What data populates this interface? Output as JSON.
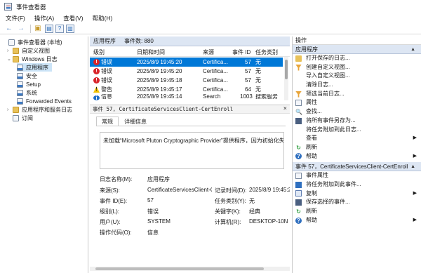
{
  "window": {
    "title": "事件查看器"
  },
  "menu": [
    "文件(F)",
    "操作(A)",
    "查看(V)",
    "帮助(H)"
  ],
  "tree": [
    {
      "label": "事件查看器 (本地)",
      "level": 0,
      "arrow": "",
      "icon": "log"
    },
    {
      "label": "自定义视图",
      "level": 1,
      "arrow": "›",
      "icon": "view"
    },
    {
      "label": "Windows 日志",
      "level": 1,
      "arrow": "⌄",
      "icon": "folder"
    },
    {
      "label": "应用程序",
      "level": 2,
      "arrow": "",
      "icon": "sub",
      "selected": true
    },
    {
      "label": "安全",
      "level": 2,
      "arrow": "",
      "icon": "sub"
    },
    {
      "label": "Setup",
      "level": 2,
      "arrow": "",
      "icon": "sub"
    },
    {
      "label": "系统",
      "level": 2,
      "arrow": "",
      "icon": "sub"
    },
    {
      "label": "Forwarded Events",
      "level": 2,
      "arrow": "",
      "icon": "sub"
    },
    {
      "label": "应用程序和服务日志",
      "level": 1,
      "arrow": "›",
      "icon": "folder"
    },
    {
      "label": "订阅",
      "level": 1,
      "arrow": "",
      "icon": "log"
    }
  ],
  "center": {
    "log_name": "应用程序",
    "event_count": "事件数: 880",
    "columns": [
      "级别",
      "日期和时间",
      "来源",
      "事件 ID",
      "任务类别"
    ],
    "rows": [
      {
        "level": "错误",
        "icon": "err",
        "datetime": "2025/8/9 19:45:20",
        "source": "Certifica...",
        "id": "57",
        "task": "无",
        "selected": true
      },
      {
        "level": "错误",
        "icon": "err",
        "datetime": "2025/8/9 19:45:20",
        "source": "Certifica...",
        "id": "57",
        "task": "无"
      },
      {
        "level": "错误",
        "icon": "err",
        "datetime": "2025/8/9 19:45:18",
        "source": "Certifica...",
        "id": "57",
        "task": "无"
      },
      {
        "level": "警告",
        "icon": "warn",
        "datetime": "2025/8/9 19:45:17",
        "source": "Certifica...",
        "id": "64",
        "task": "无"
      },
      {
        "level": "信息",
        "icon": "info",
        "datetime": "2025/8/9 19:45:14",
        "source": "Search",
        "id": "1003",
        "task": "搜索服务"
      }
    ],
    "detail": {
      "header": "事件 57, CertificateServicesClient-CertEnroll",
      "tabs": [
        "常规",
        "详细信息"
      ],
      "message": "未加载“Microsoft Pluton Cryptographic Provider”提供程序，因为初始化失",
      "fields_left": [
        {
          "label": "日志名称(M):",
          "value": "应用程序"
        },
        {
          "label": "来源(S):",
          "value": "CertificateServicesClient-C"
        },
        {
          "label": "事件 ID(E):",
          "value": "57"
        },
        {
          "label": "级别(L):",
          "value": "错误"
        },
        {
          "label": "用户(U):",
          "value": "SYSTEM"
        },
        {
          "label": "操作代码(O):",
          "value": "信息"
        }
      ],
      "fields_right": [
        {
          "label": "",
          "value": ""
        },
        {
          "label": "记录时间(D):",
          "value": "2025/8/9 19:45:20"
        },
        {
          "label": "任务类别(Y):",
          "value": "无"
        },
        {
          "label": "关键字(K):",
          "value": "经典"
        },
        {
          "label": "计算机(R):",
          "value": "DESKTOP-10N"
        },
        {
          "label": "",
          "value": ""
        }
      ]
    }
  },
  "actions": {
    "header": "操作",
    "section1": "应用程序",
    "items1": [
      {
        "label": "打开保存的日志...",
        "icon": "folder"
      },
      {
        "label": "创建自定义视图...",
        "icon": "funnel"
      },
      {
        "label": "导入自定义视图...",
        "icon": "blank"
      },
      {
        "label": "清除日志...",
        "icon": "blank"
      },
      {
        "label": "筛选当前日志...",
        "icon": "funnel"
      },
      {
        "label": "属性",
        "icon": "box"
      },
      {
        "label": "查找...",
        "icon": "find"
      },
      {
        "label": "将所有事件另存为...",
        "icon": "save"
      },
      {
        "label": "将任务附加到此日志...",
        "icon": "blank"
      },
      {
        "label": "查看",
        "icon": "blank"
      },
      {
        "label": "刷新",
        "icon": "green"
      },
      {
        "label": "帮助",
        "icon": "help"
      }
    ],
    "section2": "事件 57，CertificateServicesClient-CertEnroll",
    "items2": [
      {
        "label": "事件属性",
        "icon": "box"
      },
      {
        "label": "将任务附加到此事件...",
        "icon": "blue"
      },
      {
        "label": "复制",
        "icon": "copy"
      },
      {
        "label": "保存选择的事件...",
        "icon": "save"
      },
      {
        "label": "刷新",
        "icon": "green"
      },
      {
        "label": "帮助",
        "icon": "help"
      }
    ]
  }
}
